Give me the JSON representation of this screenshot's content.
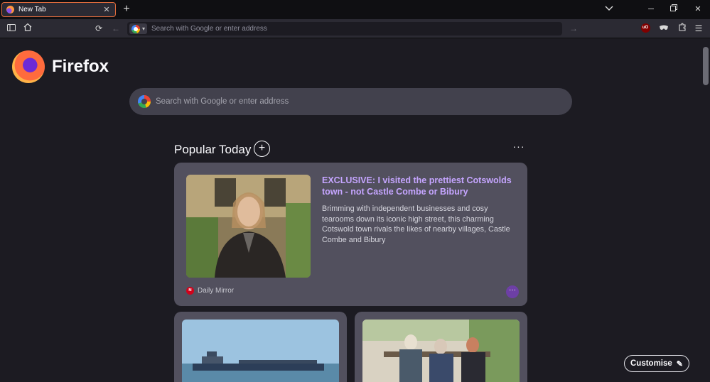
{
  "tab": {
    "title": "New Tab"
  },
  "urlbar": {
    "placeholder": "Search with Google or enter address"
  },
  "brand": {
    "name": "Firefox"
  },
  "search": {
    "placeholder": "Search with Google or enter address"
  },
  "popular": {
    "title": "Popular Today",
    "featured": {
      "title": "EXCLUSIVE: I visited the prettiest Cotswolds town - not Castle Combe or Bibury",
      "description": "Brimming with independent businesses and cosy tearooms down its iconic high street, this charming Cotswold town rivals the likes of nearby villages, Castle Combe and Bibury",
      "source": "Daily Mirror"
    }
  },
  "customise": {
    "label": "Customise"
  },
  "colors": {
    "accent": "#c5a5ff",
    "tab_border": "#e06b3c",
    "card": "#52505e"
  }
}
